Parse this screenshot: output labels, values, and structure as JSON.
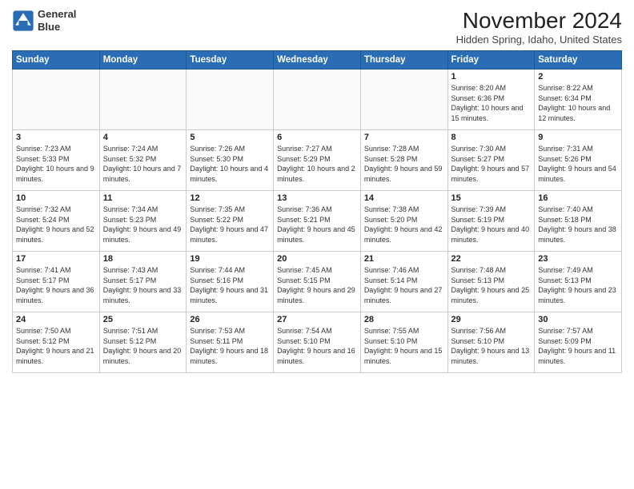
{
  "logo": {
    "line1": "General",
    "line2": "Blue"
  },
  "title": "November 2024",
  "location": "Hidden Spring, Idaho, United States",
  "weekdays": [
    "Sunday",
    "Monday",
    "Tuesday",
    "Wednesday",
    "Thursday",
    "Friday",
    "Saturday"
  ],
  "weeks": [
    [
      {
        "day": "",
        "info": ""
      },
      {
        "day": "",
        "info": ""
      },
      {
        "day": "",
        "info": ""
      },
      {
        "day": "",
        "info": ""
      },
      {
        "day": "",
        "info": ""
      },
      {
        "day": "1",
        "info": "Sunrise: 8:20 AM\nSunset: 6:36 PM\nDaylight: 10 hours and 15 minutes."
      },
      {
        "day": "2",
        "info": "Sunrise: 8:22 AM\nSunset: 6:34 PM\nDaylight: 10 hours and 12 minutes."
      }
    ],
    [
      {
        "day": "3",
        "info": "Sunrise: 7:23 AM\nSunset: 5:33 PM\nDaylight: 10 hours and 9 minutes."
      },
      {
        "day": "4",
        "info": "Sunrise: 7:24 AM\nSunset: 5:32 PM\nDaylight: 10 hours and 7 minutes."
      },
      {
        "day": "5",
        "info": "Sunrise: 7:26 AM\nSunset: 5:30 PM\nDaylight: 10 hours and 4 minutes."
      },
      {
        "day": "6",
        "info": "Sunrise: 7:27 AM\nSunset: 5:29 PM\nDaylight: 10 hours and 2 minutes."
      },
      {
        "day": "7",
        "info": "Sunrise: 7:28 AM\nSunset: 5:28 PM\nDaylight: 9 hours and 59 minutes."
      },
      {
        "day": "8",
        "info": "Sunrise: 7:30 AM\nSunset: 5:27 PM\nDaylight: 9 hours and 57 minutes."
      },
      {
        "day": "9",
        "info": "Sunrise: 7:31 AM\nSunset: 5:26 PM\nDaylight: 9 hours and 54 minutes."
      }
    ],
    [
      {
        "day": "10",
        "info": "Sunrise: 7:32 AM\nSunset: 5:24 PM\nDaylight: 9 hours and 52 minutes."
      },
      {
        "day": "11",
        "info": "Sunrise: 7:34 AM\nSunset: 5:23 PM\nDaylight: 9 hours and 49 minutes."
      },
      {
        "day": "12",
        "info": "Sunrise: 7:35 AM\nSunset: 5:22 PM\nDaylight: 9 hours and 47 minutes."
      },
      {
        "day": "13",
        "info": "Sunrise: 7:36 AM\nSunset: 5:21 PM\nDaylight: 9 hours and 45 minutes."
      },
      {
        "day": "14",
        "info": "Sunrise: 7:38 AM\nSunset: 5:20 PM\nDaylight: 9 hours and 42 minutes."
      },
      {
        "day": "15",
        "info": "Sunrise: 7:39 AM\nSunset: 5:19 PM\nDaylight: 9 hours and 40 minutes."
      },
      {
        "day": "16",
        "info": "Sunrise: 7:40 AM\nSunset: 5:18 PM\nDaylight: 9 hours and 38 minutes."
      }
    ],
    [
      {
        "day": "17",
        "info": "Sunrise: 7:41 AM\nSunset: 5:17 PM\nDaylight: 9 hours and 36 minutes."
      },
      {
        "day": "18",
        "info": "Sunrise: 7:43 AM\nSunset: 5:17 PM\nDaylight: 9 hours and 33 minutes."
      },
      {
        "day": "19",
        "info": "Sunrise: 7:44 AM\nSunset: 5:16 PM\nDaylight: 9 hours and 31 minutes."
      },
      {
        "day": "20",
        "info": "Sunrise: 7:45 AM\nSunset: 5:15 PM\nDaylight: 9 hours and 29 minutes."
      },
      {
        "day": "21",
        "info": "Sunrise: 7:46 AM\nSunset: 5:14 PM\nDaylight: 9 hours and 27 minutes."
      },
      {
        "day": "22",
        "info": "Sunrise: 7:48 AM\nSunset: 5:13 PM\nDaylight: 9 hours and 25 minutes."
      },
      {
        "day": "23",
        "info": "Sunrise: 7:49 AM\nSunset: 5:13 PM\nDaylight: 9 hours and 23 minutes."
      }
    ],
    [
      {
        "day": "24",
        "info": "Sunrise: 7:50 AM\nSunset: 5:12 PM\nDaylight: 9 hours and 21 minutes."
      },
      {
        "day": "25",
        "info": "Sunrise: 7:51 AM\nSunset: 5:12 PM\nDaylight: 9 hours and 20 minutes."
      },
      {
        "day": "26",
        "info": "Sunrise: 7:53 AM\nSunset: 5:11 PM\nDaylight: 9 hours and 18 minutes."
      },
      {
        "day": "27",
        "info": "Sunrise: 7:54 AM\nSunset: 5:10 PM\nDaylight: 9 hours and 16 minutes."
      },
      {
        "day": "28",
        "info": "Sunrise: 7:55 AM\nSunset: 5:10 PM\nDaylight: 9 hours and 15 minutes."
      },
      {
        "day": "29",
        "info": "Sunrise: 7:56 AM\nSunset: 5:10 PM\nDaylight: 9 hours and 13 minutes."
      },
      {
        "day": "30",
        "info": "Sunrise: 7:57 AM\nSunset: 5:09 PM\nDaylight: 9 hours and 11 minutes."
      }
    ]
  ]
}
